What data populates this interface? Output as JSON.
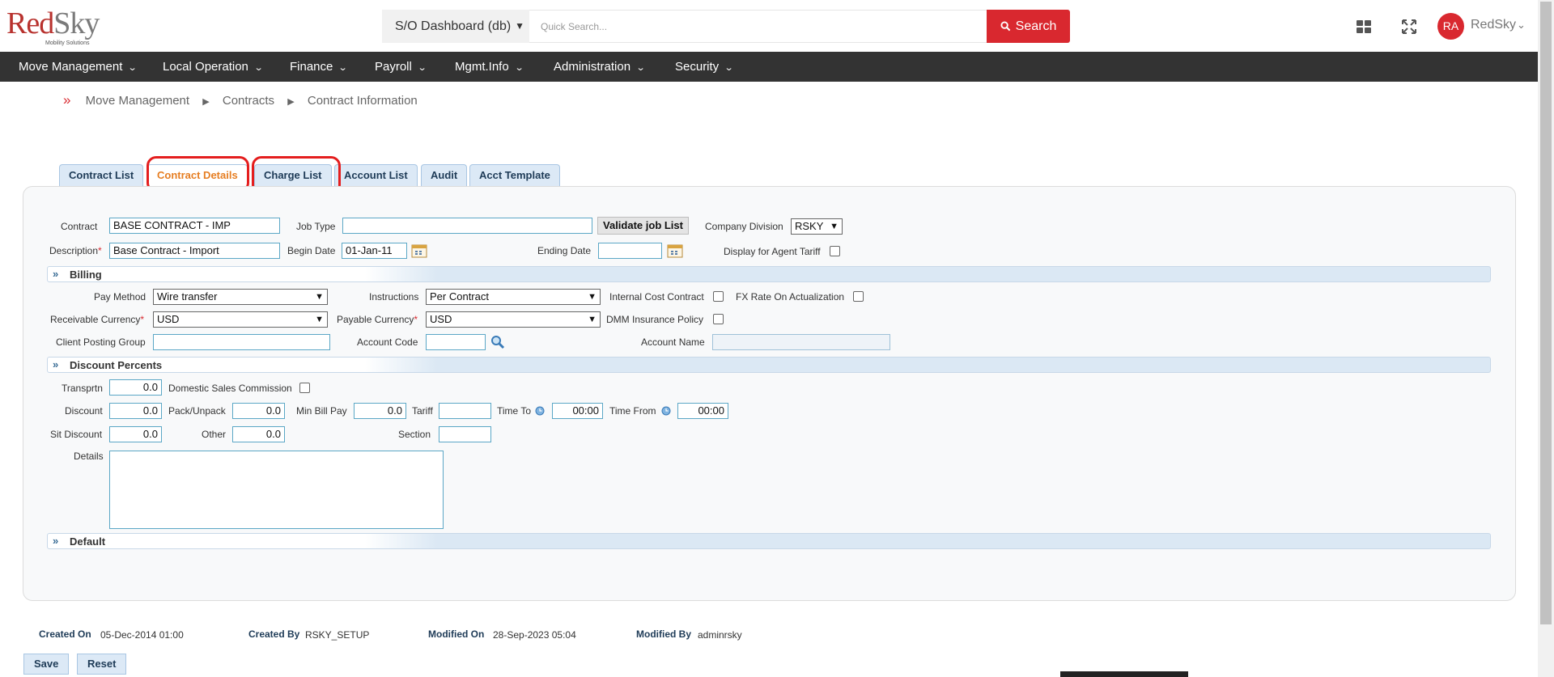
{
  "header": {
    "logo_red": "Red",
    "logo_gray": "Sky",
    "logo_tagline": "Mobility Solutions",
    "dashboard_select": "S/O Dashboard (db)",
    "search_placeholder": "Quick Search...",
    "search_button": "Search",
    "user_initials": "RA",
    "user_name": "RedSky"
  },
  "nav": {
    "items": [
      {
        "label": "Move Management"
      },
      {
        "label": "Local Operation"
      },
      {
        "label": "Finance"
      },
      {
        "label": "Payroll"
      },
      {
        "label": "Mgmt.Info"
      },
      {
        "label": "Administration"
      },
      {
        "label": "Security"
      }
    ]
  },
  "breadcrumb": [
    "Move Management",
    "Contracts",
    "Contract Information"
  ],
  "tabs": [
    {
      "label": "Contract List",
      "active": false
    },
    {
      "label": "Contract Details",
      "active": true
    },
    {
      "label": "Charge List",
      "active": false
    },
    {
      "label": "Account List",
      "active": false
    },
    {
      "label": "Audit",
      "active": false
    },
    {
      "label": "Acct Template",
      "active": false
    }
  ],
  "form": {
    "contract_label": "Contract",
    "contract_value": "BASE CONTRACT - IMP",
    "job_type_label": "Job Type",
    "job_type_value": "",
    "validate_button": "Validate job List",
    "company_division_label": "Company Division",
    "company_division_value": "RSKY",
    "description_label": "Description",
    "description_value": "Base Contract - Import",
    "begin_date_label": "Begin Date",
    "begin_date_value": "01-Jan-11",
    "ending_date_label": "Ending Date",
    "ending_date_value": "",
    "agent_tariff_label": "Display for Agent Tariff",
    "required_mark": "*"
  },
  "billing": {
    "title": "Billing",
    "pay_method_label": "Pay Method",
    "pay_method_value": "Wire transfer",
    "instructions_label": "Instructions",
    "instructions_value": "Per Contract",
    "internal_cost_label": "Internal Cost Contract",
    "fx_rate_label": "FX Rate On Actualization",
    "receivable_currency_label": "Receivable Currency",
    "receivable_currency_value": "USD",
    "payable_currency_label": "Payable Currency",
    "payable_currency_value": "USD",
    "dmm_label": "DMM Insurance Policy",
    "client_posting_label": "Client Posting Group",
    "client_posting_value": "",
    "account_code_label": "Account Code",
    "account_code_value": "",
    "account_name_label": "Account Name",
    "account_name_value": ""
  },
  "discount": {
    "title": "Discount Percents",
    "transprtn_label": "Transprtn",
    "transprtn_value": "0.0",
    "domestic_sales_label": "Domestic Sales Commission",
    "discount_label": "Discount",
    "discount_value": "0.0",
    "pack_unpack_label": "Pack/Unpack",
    "pack_unpack_value": "0.0",
    "min_bill_label": "Min Bill Pay",
    "min_bill_value": "0.0",
    "tariff_label": "Tariff",
    "tariff_value": "",
    "time_to_label": "Time To",
    "time_to_value": "00:00",
    "time_from_label": "Time From",
    "time_from_value": "00:00",
    "sit_discount_label": "Sit Discount",
    "sit_discount_value": "0.0",
    "other_label": "Other",
    "other_value": "0.0",
    "section_label": "Section",
    "section_value": "",
    "details_label": "Details"
  },
  "default_section": {
    "title": "Default"
  },
  "footer": {
    "created_on_label": "Created On",
    "created_on_value": "05-Dec-2014 01:00",
    "created_by_label": "Created By",
    "created_by_value": "RSKY_SETUP",
    "modified_on_label": "Modified On",
    "modified_on_value": "28-Sep-2023 05:04",
    "modified_by_label": "Modified By",
    "modified_by_value": "adminrsky",
    "save_button": "Save",
    "reset_button": "Reset"
  },
  "colors": {
    "brand_red": "#d9282f",
    "nav_bg": "#333333",
    "tab_bg": "#dce9f6",
    "active_tab_text": "#e67e22",
    "highlight_ring": "#e41e1e"
  }
}
